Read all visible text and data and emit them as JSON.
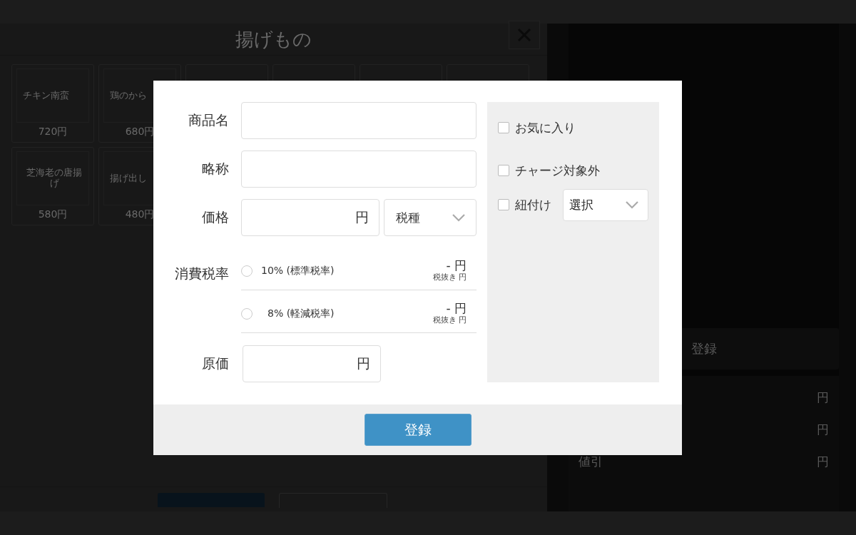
{
  "category_panel": {
    "title": "揚げもの",
    "product_rows": [
      [
        {
          "name": "チキン南蛮",
          "price": "720円"
        },
        {
          "name": "鶏のから",
          "price": "680円"
        }
      ],
      [
        {
          "name": "芝海老の唐揚げ",
          "price": "580円"
        },
        {
          "name": "揚げ出し",
          "price": "480円"
        }
      ]
    ]
  },
  "order_panel": {
    "register_button": "登録",
    "summary_rows": [
      {
        "value": "円"
      },
      {
        "value": "円"
      },
      {
        "label": "値引",
        "value": "円"
      }
    ]
  },
  "dialog": {
    "fields": [
      {
        "kind": "text",
        "label": "商品名"
      },
      {
        "kind": "text",
        "label": "略称"
      },
      {
        "kind": "price",
        "label": "価格",
        "unit": "円",
        "select": "税種"
      }
    ],
    "tax": {
      "label": "消費税率",
      "options": [
        {
          "label": "10% (標準税率)",
          "amount": "- 円",
          "note": "税抜き 円",
          "selected": false
        },
        {
          "label": "8% (軽減税率)",
          "amount": "- 円",
          "note": "税抜き 円",
          "selected": false
        }
      ]
    },
    "cost": {
      "label": "原価",
      "unit": "円"
    },
    "options": [
      {
        "kind": "checkbox",
        "label": "お気に入り",
        "checked": false
      },
      {
        "kind": "checkbox",
        "label": "チャージ対象外",
        "checked": false
      },
      {
        "kind": "checkbox_select",
        "label": "紐付け",
        "checked": false,
        "select": "選択"
      }
    ],
    "submit": "登録"
  }
}
